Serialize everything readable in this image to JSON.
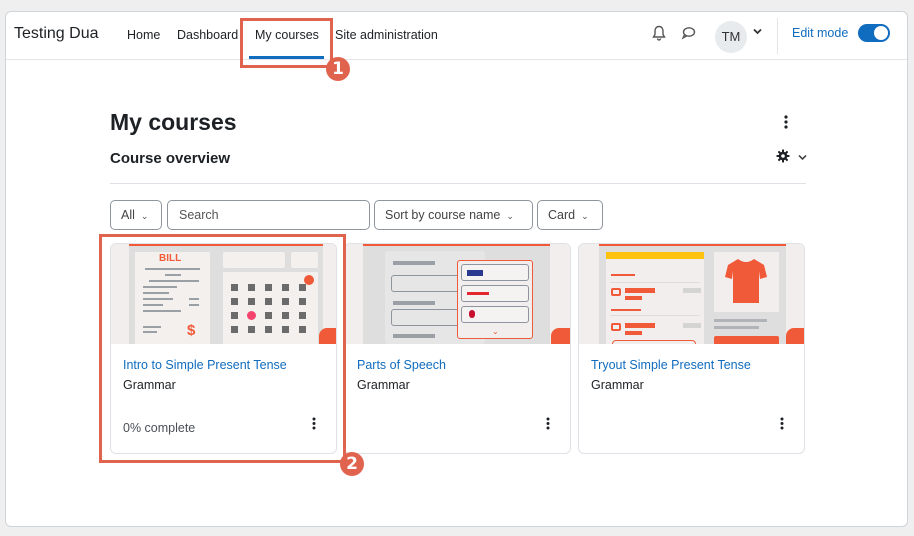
{
  "navbar": {
    "brand": "Testing Dua",
    "links": [
      {
        "label": "Home",
        "active": false
      },
      {
        "label": "Dashboard",
        "active": false
      },
      {
        "label": "My courses",
        "active": true
      },
      {
        "label": "Site administration",
        "active": false
      }
    ],
    "notifications_icon": "bell-icon",
    "messages_icon": "chat-bubble-icon",
    "user_initials": "TM",
    "edit_mode_label": "Edit mode",
    "edit_mode_on": true
  },
  "page": {
    "title": "My courses",
    "section_title": "Course overview"
  },
  "filters": {
    "grouping": "All",
    "search_placeholder": "Search",
    "sort": "Sort by course name",
    "view": "Card"
  },
  "courses": [
    {
      "title": "Intro to Simple Present Tense",
      "category": "Grammar",
      "progress_text": "0% complete",
      "progress_percent": 0
    },
    {
      "title": "Parts of Speech",
      "category": "Grammar",
      "progress_text": ""
    },
    {
      "title": "Tryout Simple Present Tense",
      "category": "Grammar",
      "progress_text": ""
    }
  ],
  "annotations": {
    "step1": "1",
    "step2": "2"
  },
  "illustrations": {
    "bill_label": "BILL",
    "dollar": "$"
  },
  "colors": {
    "accent": "#0f6cbf",
    "annotation": "#e0634d",
    "illustration": "#f05a38"
  }
}
